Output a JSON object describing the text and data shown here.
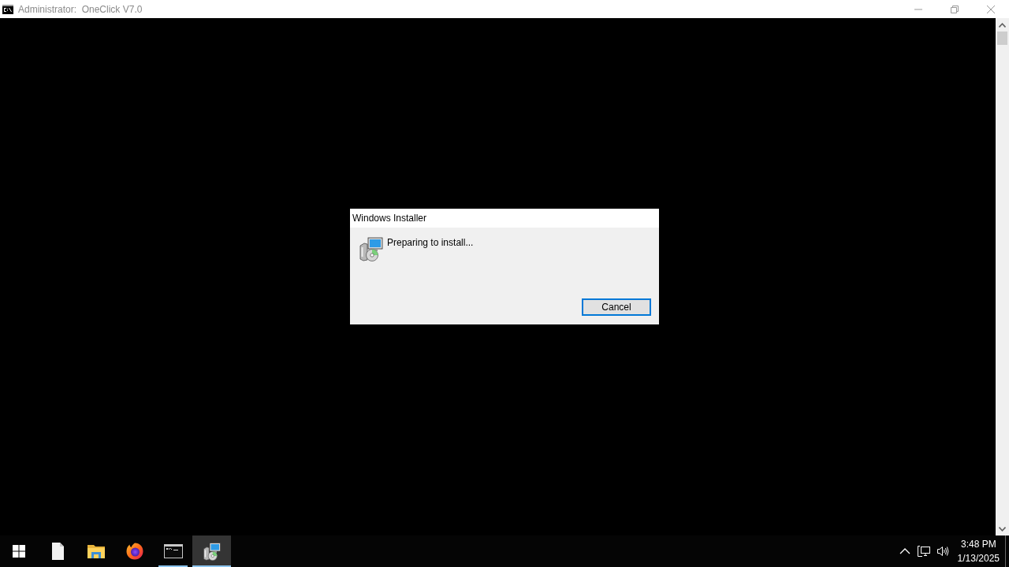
{
  "console_window": {
    "title": "Administrator:  OneClick V7.0",
    "active": false
  },
  "installer_dialog": {
    "title": "Windows Installer",
    "message": "Preparing to install...",
    "buttons": [
      {
        "label": "Cancel",
        "default": true
      }
    ]
  },
  "taskbar": {
    "apps": [
      {
        "kind": "document",
        "running": false,
        "selected": false
      },
      {
        "kind": "folder",
        "running": false,
        "selected": false
      },
      {
        "kind": "browser",
        "running": false,
        "selected": false
      },
      {
        "kind": "terminal",
        "running": true,
        "selected": false
      },
      {
        "kind": "installer",
        "running": true,
        "selected": true
      }
    ],
    "clock": {
      "time": "3:48 PM",
      "date": "1/13/2025"
    }
  }
}
